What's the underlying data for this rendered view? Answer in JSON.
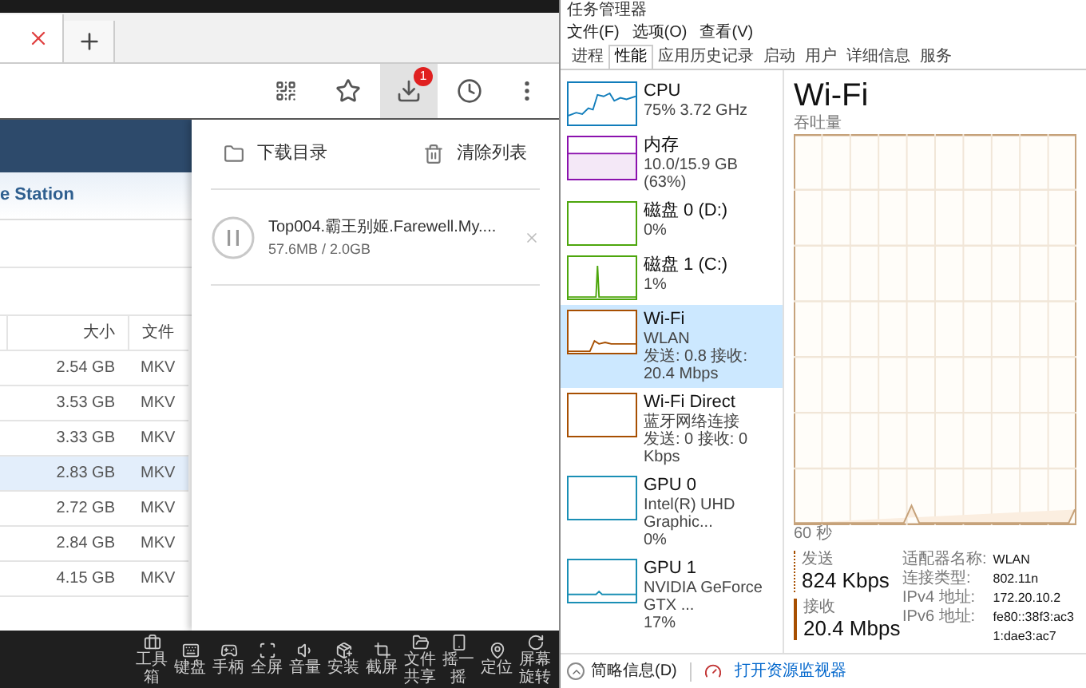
{
  "browser": {
    "toolbar": {
      "download_badge": "1"
    },
    "page": {
      "header": "e Station",
      "columns": [
        "大小",
        "文件"
      ],
      "rows": [
        {
          "size": "2.54 GB",
          "type": "MKV",
          "selected": false
        },
        {
          "size": "3.53 GB",
          "type": "MKV",
          "selected": false
        },
        {
          "size": "3.33 GB",
          "type": "MKV",
          "selected": false
        },
        {
          "size": "2.83 GB",
          "type": "MKV",
          "selected": true
        },
        {
          "size": "2.72 GB",
          "type": "MKV",
          "selected": false
        },
        {
          "size": "2.84 GB",
          "type": "MKV",
          "selected": false
        },
        {
          "size": "4.15 GB",
          "type": "MKV",
          "selected": false
        }
      ]
    },
    "download_panel": {
      "open_folder": "下载目录",
      "clear_list": "清除列表",
      "items": [
        {
          "name": "Top004.霸王别姬.Farewell.My....",
          "progress": "57.6MB / 2.0GB"
        }
      ]
    },
    "tools": [
      {
        "kind": "toolbox",
        "label": "工具箱"
      },
      {
        "kind": "keyboard",
        "label": "键盘"
      },
      {
        "kind": "gamepad",
        "label": "手柄"
      },
      {
        "kind": "fullscreen",
        "label": "全屏"
      },
      {
        "kind": "volume",
        "label": "音量"
      },
      {
        "kind": "install",
        "label": "安装"
      },
      {
        "kind": "screenshot",
        "label": "截屏"
      },
      {
        "kind": "share",
        "label": "文件共享"
      },
      {
        "kind": "shake",
        "label": "摇一摇"
      },
      {
        "kind": "location",
        "label": "定位"
      },
      {
        "kind": "rotate",
        "label": "屏幕旋转"
      }
    ]
  },
  "task_manager": {
    "title": "任务管理器",
    "menu": [
      "文件(F)",
      "选项(O)",
      "查看(V)"
    ],
    "tabs": [
      {
        "label": "进程",
        "selected": false
      },
      {
        "label": "性能",
        "selected": true
      },
      {
        "label": "应用历史记录",
        "selected": false
      },
      {
        "label": "启动",
        "selected": false
      },
      {
        "label": "用户",
        "selected": false
      },
      {
        "label": "详细信息",
        "selected": false
      },
      {
        "label": "服务",
        "selected": false
      }
    ],
    "resources": [
      {
        "kind": "cpu",
        "name": "CPU",
        "details": [
          "75% 3.72 GHz"
        ],
        "color": "#117dbb",
        "selected": false
      },
      {
        "kind": "memory",
        "name": "内存",
        "details": [
          "10.0/15.9 GB (63%)"
        ],
        "color": "#8b12ae",
        "selected": false
      },
      {
        "kind": "disk",
        "name": "磁盘 0 (D:)",
        "details": [
          "0%"
        ],
        "color": "#4da60c",
        "selected": false
      },
      {
        "kind": "disk_spike",
        "name": "磁盘 1 (C:)",
        "details": [
          "1%"
        ],
        "color": "#4da60c",
        "selected": false
      },
      {
        "kind": "network",
        "name": "Wi-Fi",
        "details": [
          "WLAN",
          "发送: 0.8 接收: 20.4 Mbps"
        ],
        "color": "#a74f01",
        "selected": true
      },
      {
        "kind": "idle",
        "name": "Wi-Fi Direct",
        "details": [
          "蓝牙网络连接",
          "发送: 0 接收: 0 Kbps"
        ],
        "color": "#a74f01",
        "selected": false
      },
      {
        "kind": "idle",
        "name": "GPU 0",
        "details": [
          "Intel(R) UHD Graphic...",
          "0%"
        ],
        "color": "#1a8fb5",
        "selected": false
      },
      {
        "kind": "gpu",
        "name": "GPU 1",
        "details": [
          "NVIDIA GeForce GTX ...",
          "17%"
        ],
        "color": "#1a8fb5",
        "selected": false
      }
    ],
    "detail": {
      "title": "Wi-Fi",
      "chart_label": "吞吐量",
      "time_label": "60 秒",
      "send": {
        "label": "发送",
        "value": "824 Kbps"
      },
      "receive": {
        "label": "接收",
        "value": "20.4 Mbps"
      },
      "properties": [
        {
          "label": "适配器名称:",
          "value": "WLAN"
        },
        {
          "label": "连接类型:",
          "value": "802.11n"
        },
        {
          "label": "IPv4 地址:",
          "value": "172.20.10.2"
        },
        {
          "label": "IPv6 地址:",
          "value": "fe80::38f3:ac31:dae3:ac7"
        }
      ]
    },
    "footer": {
      "fewer_details": "简略信息(D)",
      "open_monitor": "打开资源监视器"
    }
  }
}
